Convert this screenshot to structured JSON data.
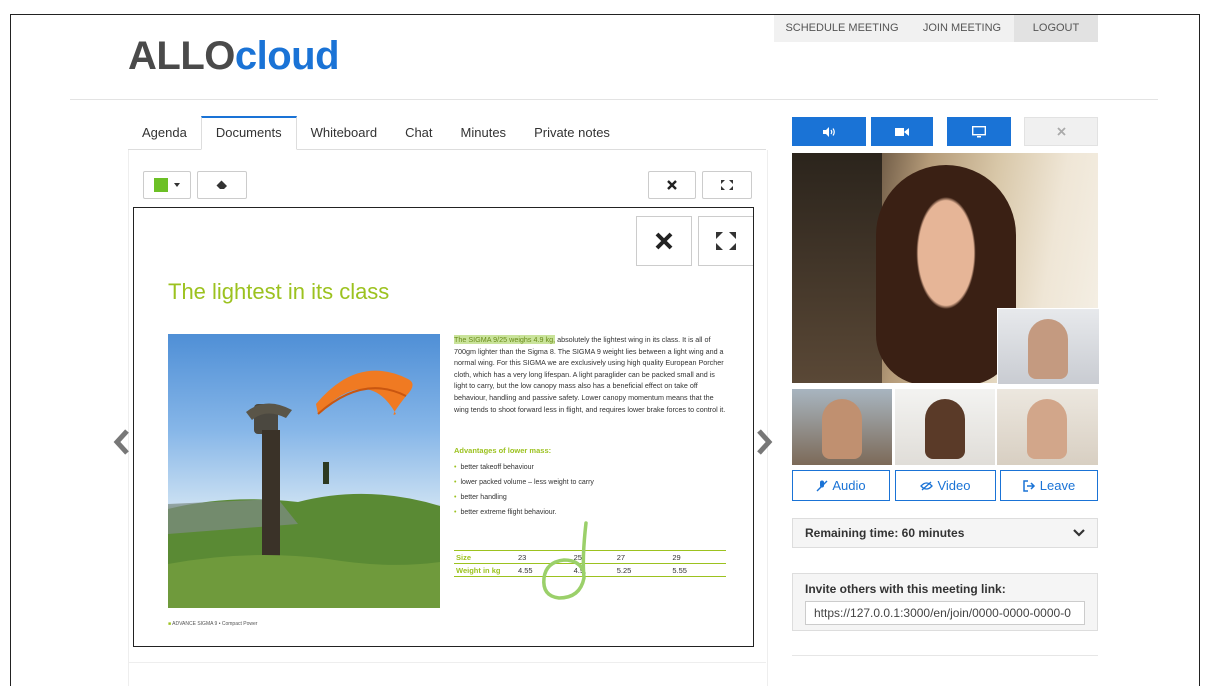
{
  "brand": {
    "part1": "ALLO",
    "part2": "cloud",
    "color_dark": "#4a4a4a",
    "color_blue": "#1a73d6"
  },
  "topnav": {
    "schedule": "SCHEDULE MEETING",
    "join": "JOIN MEETING",
    "logout": "LOGOUT"
  },
  "tabs": [
    "Agenda",
    "Documents",
    "Whiteboard",
    "Chat",
    "Minutes",
    "Private notes"
  ],
  "active_tab": "Documents",
  "toolbar": {
    "pen_color": "#6cc026",
    "eraser_icon": "eraser-icon",
    "close_icon": "close-icon",
    "fullscreen_icon": "fullscreen-icon"
  },
  "document": {
    "title": "The lightest in its class",
    "para_highlight": "The SIGMA 9/25 weighs 4.9 kg,",
    "para_rest": " absolutely the lightest wing in its class. It is all of 700gm lighter than the Sigma 8. The SIGMA 9 weight lies between a light wing and a normal wing. For this SIGMA we are exclusively using high quality European Porcher cloth, which has a very long lifespan. A light paraglider can be packed small and is light to carry, but the low canopy mass also has a beneficial effect on take off behaviour, handling and passive safety. Lower canopy momentum means that the wing tends to shoot forward less in flight, and requires lower brake forces to control it.",
    "advantages_title": "Advantages of lower mass:",
    "advantages": [
      "better takeoff behaviour",
      "lower packed volume – less weight to carry",
      "better handling",
      "better extreme flight behaviour."
    ],
    "spec_rows": [
      {
        "label": "Size",
        "values": [
          "23",
          "25",
          "27",
          "29"
        ]
      },
      {
        "label": "Weight in kg",
        "values": [
          "4.55",
          "4.9",
          "5.25",
          "5.55"
        ]
      }
    ],
    "caption": "ADVANCE SIGMA 9 • Compact Power",
    "accent": "#9cc21f"
  },
  "nav": {
    "prev_icon": "chevron-left-icon",
    "next_icon": "chevron-right-icon"
  },
  "media_controls": {
    "audio_icon": "speaker-icon",
    "video_icon": "camera-icon",
    "screen_icon": "monitor-icon",
    "close_icon": "close-icon"
  },
  "call_buttons": {
    "audio": "Audio",
    "video": "Video",
    "leave": "Leave"
  },
  "remaining": {
    "label": "Remaining time: 60 minutes"
  },
  "invite": {
    "label": "Invite others with this meeting link:",
    "link": "https://127.0.0.1:3000/en/join/0000-0000-0000-0"
  }
}
